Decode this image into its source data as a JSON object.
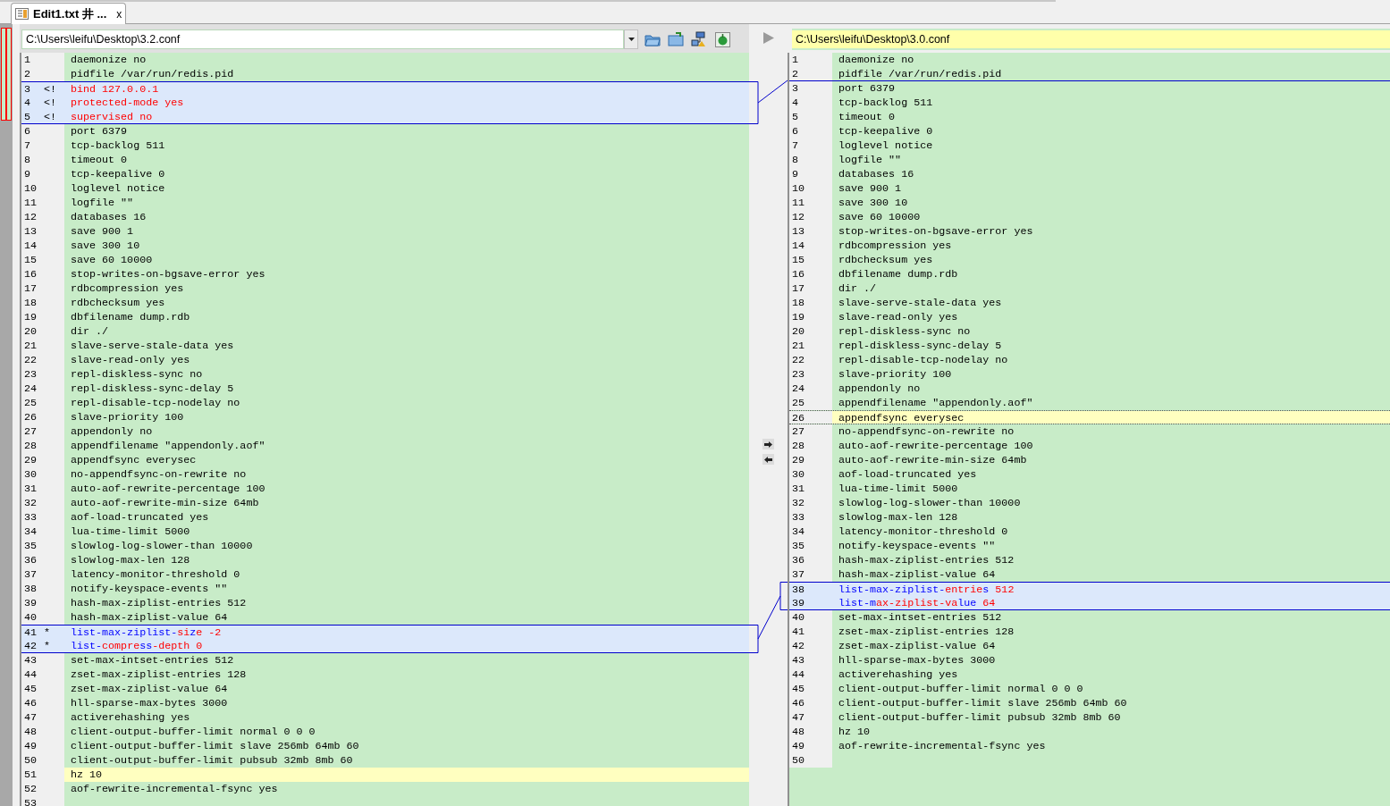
{
  "tab": {
    "title": "Edit1.txt 井 ...",
    "close": "x",
    "selected": true
  },
  "left": {
    "path": "C:\\Users\\leifu\\Desktop\\3.2.conf",
    "lines": [
      {
        "number": "1",
        "kind": "same",
        "text": "daemonize no"
      },
      {
        "number": "2",
        "kind": "same",
        "text": "pidfile /var/run/redis.pid"
      },
      {
        "number": "3",
        "kind": "changed",
        "marker": "<!",
        "segments": [
          {
            "text": "bind 127.0.0.1",
            "changed": true
          }
        ]
      },
      {
        "number": "4",
        "kind": "changed",
        "marker": "<!",
        "segments": [
          {
            "text": "protected-mode yes",
            "changed": true
          }
        ]
      },
      {
        "number": "5",
        "kind": "changed",
        "marker": "<!",
        "segments": [
          {
            "text": "supervised no",
            "changed": true
          }
        ]
      },
      {
        "number": "6",
        "kind": "same",
        "text": "port 6379"
      },
      {
        "number": "7",
        "kind": "same",
        "text": "tcp-backlog 511"
      },
      {
        "number": "8",
        "kind": "same",
        "text": "timeout 0"
      },
      {
        "number": "9",
        "kind": "same",
        "text": "tcp-keepalive 0"
      },
      {
        "number": "10",
        "kind": "same",
        "text": "loglevel notice"
      },
      {
        "number": "11",
        "kind": "same",
        "text": "logfile \"\""
      },
      {
        "number": "12",
        "kind": "same",
        "text": "databases 16"
      },
      {
        "number": "13",
        "kind": "same",
        "text": "save 900 1"
      },
      {
        "number": "14",
        "kind": "same",
        "text": "save 300 10"
      },
      {
        "number": "15",
        "kind": "same",
        "text": "save 60 10000"
      },
      {
        "number": "16",
        "kind": "same",
        "text": "stop-writes-on-bgsave-error yes"
      },
      {
        "number": "17",
        "kind": "same",
        "text": "rdbcompression yes"
      },
      {
        "number": "18",
        "kind": "same",
        "text": "rdbchecksum yes"
      },
      {
        "number": "19",
        "kind": "same",
        "text": "dbfilename dump.rdb"
      },
      {
        "number": "20",
        "kind": "same",
        "text": "dir ./"
      },
      {
        "number": "21",
        "kind": "same",
        "text": "slave-serve-stale-data yes"
      },
      {
        "number": "22",
        "kind": "same",
        "text": "slave-read-only yes"
      },
      {
        "number": "23",
        "kind": "same",
        "text": "repl-diskless-sync no"
      },
      {
        "number": "24",
        "kind": "same",
        "text": "repl-diskless-sync-delay 5"
      },
      {
        "number": "25",
        "kind": "same",
        "text": "repl-disable-tcp-nodelay no"
      },
      {
        "number": "26",
        "kind": "same",
        "text": "slave-priority 100"
      },
      {
        "number": "27",
        "kind": "same",
        "text": "appendonly no"
      },
      {
        "number": "28",
        "kind": "same",
        "text": "appendfilename \"appendonly.aof\""
      },
      {
        "number": "29",
        "kind": "same",
        "text": "appendfsync everysec"
      },
      {
        "number": "30",
        "kind": "same",
        "text": "no-appendfsync-on-rewrite no"
      },
      {
        "number": "31",
        "kind": "same",
        "text": "auto-aof-rewrite-percentage 100"
      },
      {
        "number": "32",
        "kind": "same",
        "text": "auto-aof-rewrite-min-size 64mb"
      },
      {
        "number": "33",
        "kind": "same",
        "text": "aof-load-truncated yes"
      },
      {
        "number": "34",
        "kind": "same",
        "text": "lua-time-limit 5000"
      },
      {
        "number": "35",
        "kind": "same",
        "text": "slowlog-log-slower-than 10000"
      },
      {
        "number": "36",
        "kind": "same",
        "text": "slowlog-max-len 128"
      },
      {
        "number": "37",
        "kind": "same",
        "text": "latency-monitor-threshold 0"
      },
      {
        "number": "38",
        "kind": "same",
        "text": "notify-keyspace-events \"\""
      },
      {
        "number": "39",
        "kind": "same",
        "text": "hash-max-ziplist-entries 512"
      },
      {
        "number": "40",
        "kind": "same",
        "text": "hash-max-ziplist-value 64"
      },
      {
        "number": "41",
        "kind": "changed",
        "marker": "*",
        "segments": [
          {
            "text": "list-max-ziplist-",
            "changed": false
          },
          {
            "text": "si",
            "changed": true
          },
          {
            "text": "z",
            "changed": false
          },
          {
            "text": "e -2",
            "changed": true
          }
        ]
      },
      {
        "number": "42",
        "kind": "changed",
        "marker": "*",
        "segments": [
          {
            "text": "list-",
            "changed": false
          },
          {
            "text": "compre",
            "changed": true
          },
          {
            "text": "ss",
            "changed": false
          },
          {
            "text": "-depth 0",
            "changed": true
          }
        ]
      },
      {
        "number": "43",
        "kind": "same",
        "text": "set-max-intset-entries 512"
      },
      {
        "number": "44",
        "kind": "same",
        "text": "zset-max-ziplist-entries 128"
      },
      {
        "number": "45",
        "kind": "same",
        "text": "zset-max-ziplist-value 64"
      },
      {
        "number": "46",
        "kind": "same",
        "text": "hll-sparse-max-bytes 3000"
      },
      {
        "number": "47",
        "kind": "same",
        "text": "activerehashing yes"
      },
      {
        "number": "48",
        "kind": "same",
        "text": "client-output-buffer-limit normal 0 0 0"
      },
      {
        "number": "49",
        "kind": "same",
        "text": "client-output-buffer-limit slave 256mb 64mb 60"
      },
      {
        "number": "50",
        "kind": "same",
        "text": "client-output-buffer-limit pubsub 32mb 8mb 60"
      },
      {
        "number": "51",
        "kind": "current",
        "text": "hz 10"
      },
      {
        "number": "52",
        "kind": "same",
        "text": "aof-rewrite-incremental-fsync yes"
      },
      {
        "number": "53",
        "kind": "same"
      }
    ]
  },
  "right": {
    "path": "C:\\Users\\leifu\\Desktop\\3.0.conf",
    "lines": [
      {
        "number": "1",
        "kind": "same",
        "text": "daemonize no"
      },
      {
        "number": "2",
        "kind": "same",
        "text": "pidfile /var/run/redis.pid",
        "gap_below": true
      },
      {
        "number": "3",
        "kind": "same",
        "text": "port 6379"
      },
      {
        "number": "4",
        "kind": "same",
        "text": "tcp-backlog 511"
      },
      {
        "number": "5",
        "kind": "same",
        "text": "timeout 0"
      },
      {
        "number": "6",
        "kind": "same",
        "text": "tcp-keepalive 0"
      },
      {
        "number": "7",
        "kind": "same",
        "text": "loglevel notice"
      },
      {
        "number": "8",
        "kind": "same",
        "text": "logfile \"\""
      },
      {
        "number": "9",
        "kind": "same",
        "text": "databases 16"
      },
      {
        "number": "10",
        "kind": "same",
        "text": "save 900 1"
      },
      {
        "number": "11",
        "kind": "same",
        "text": "save 300 10"
      },
      {
        "number": "12",
        "kind": "same",
        "text": "save 60 10000"
      },
      {
        "number": "13",
        "kind": "same",
        "text": "stop-writes-on-bgsave-error yes"
      },
      {
        "number": "14",
        "kind": "same",
        "text": "rdbcompression yes"
      },
      {
        "number": "15",
        "kind": "same",
        "text": "rdbchecksum yes"
      },
      {
        "number": "16",
        "kind": "same",
        "text": "dbfilename dump.rdb"
      },
      {
        "number": "17",
        "kind": "same",
        "text": "dir ./"
      },
      {
        "number": "18",
        "kind": "same",
        "text": "slave-serve-stale-data yes"
      },
      {
        "number": "19",
        "kind": "same",
        "text": "slave-read-only yes"
      },
      {
        "number": "20",
        "kind": "same",
        "text": "repl-diskless-sync no"
      },
      {
        "number": "21",
        "kind": "same",
        "text": "repl-diskless-sync-delay 5"
      },
      {
        "number": "22",
        "kind": "same",
        "text": "repl-disable-tcp-nodelay no"
      },
      {
        "number": "23",
        "kind": "same",
        "text": "slave-priority 100"
      },
      {
        "number": "24",
        "kind": "same",
        "text": "appendonly no"
      },
      {
        "number": "25",
        "kind": "same",
        "text": "appendfilename \"appendonly.aof\""
      },
      {
        "number": "26",
        "kind": "current",
        "text": "appendfsync everysec"
      },
      {
        "number": "27",
        "kind": "same",
        "text": "no-appendfsync-on-rewrite no"
      },
      {
        "number": "28",
        "kind": "same",
        "text": "auto-aof-rewrite-percentage 100"
      },
      {
        "number": "29",
        "kind": "same",
        "text": "auto-aof-rewrite-min-size 64mb"
      },
      {
        "number": "30",
        "kind": "same",
        "text": "aof-load-truncated yes"
      },
      {
        "number": "31",
        "kind": "same",
        "text": "lua-time-limit 5000"
      },
      {
        "number": "32",
        "kind": "same",
        "text": "slowlog-log-slower-than 10000"
      },
      {
        "number": "33",
        "kind": "same",
        "text": "slowlog-max-len 128"
      },
      {
        "number": "34",
        "kind": "same",
        "text": "latency-monitor-threshold 0"
      },
      {
        "number": "35",
        "kind": "same",
        "text": "notify-keyspace-events \"\""
      },
      {
        "number": "36",
        "kind": "same",
        "text": "hash-max-ziplist-entries 512"
      },
      {
        "number": "37",
        "kind": "same",
        "text": "hash-max-ziplist-value 64"
      },
      {
        "number": "38",
        "kind": "changed",
        "segments": [
          {
            "text": "list-max-ziplist-",
            "changed": false
          },
          {
            "text": "entrie",
            "changed": true
          },
          {
            "text": "s",
            "changed": false
          },
          {
            "text": " 512",
            "changed": true
          }
        ]
      },
      {
        "number": "39",
        "kind": "changed",
        "segments": [
          {
            "text": "list-m",
            "changed": false
          },
          {
            "text": "ax-ziplist-va",
            "changed": true
          },
          {
            "text": "lue",
            "changed": false
          },
          {
            "text": " 64",
            "changed": true
          }
        ]
      },
      {
        "number": "40",
        "kind": "same",
        "text": "set-max-intset-entries 512"
      },
      {
        "number": "41",
        "kind": "same",
        "text": "zset-max-ziplist-entries 128"
      },
      {
        "number": "42",
        "kind": "same",
        "text": "zset-max-ziplist-value 64"
      },
      {
        "number": "43",
        "kind": "same",
        "text": "hll-sparse-max-bytes 3000"
      },
      {
        "number": "44",
        "kind": "same",
        "text": "activerehashing yes"
      },
      {
        "number": "45",
        "kind": "same",
        "text": "client-output-buffer-limit normal 0 0 0"
      },
      {
        "number": "46",
        "kind": "same",
        "text": "client-output-buffer-limit slave 256mb 64mb 60"
      },
      {
        "number": "47",
        "kind": "same",
        "text": "client-output-buffer-limit pubsub 32mb 8mb 60"
      },
      {
        "number": "48",
        "kind": "same",
        "text": "hz 10"
      },
      {
        "number": "49",
        "kind": "same",
        "text": "aof-rewrite-incremental-fsync yes"
      },
      {
        "number": "50",
        "kind": "same"
      }
    ]
  }
}
